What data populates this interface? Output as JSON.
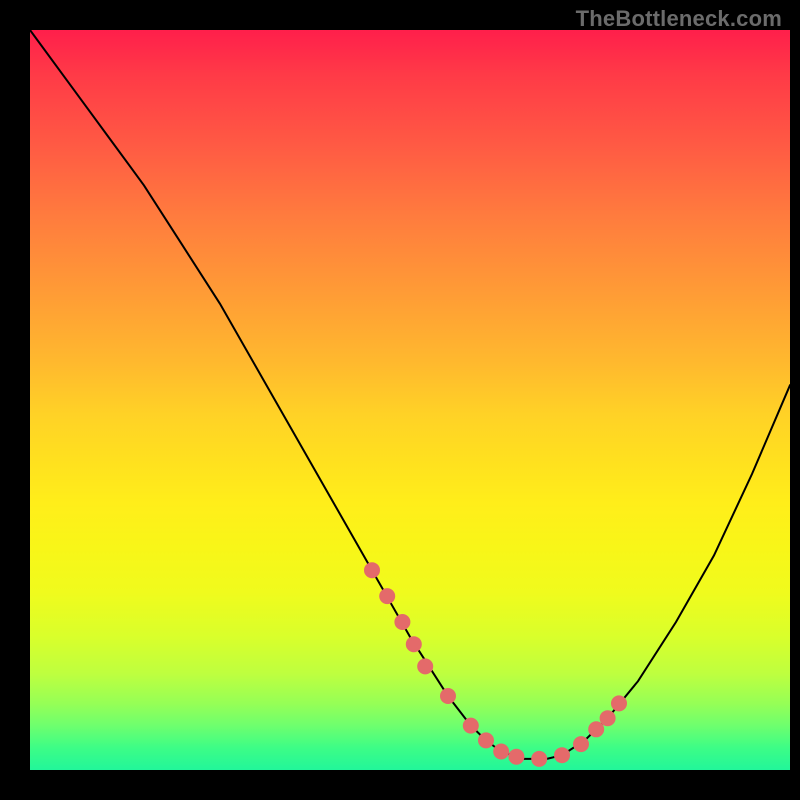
{
  "watermark": "TheBottleneck.com",
  "chart_data": {
    "type": "line",
    "title": "",
    "xlabel": "",
    "ylabel": "",
    "xlim": [
      0,
      100
    ],
    "ylim": [
      0,
      100
    ],
    "series": [
      {
        "name": "curve",
        "x": [
          0,
          5,
          10,
          15,
          20,
          25,
          30,
          35,
          40,
          45,
          50,
          55,
          58,
          60,
          62,
          65,
          68,
          70,
          73,
          76,
          80,
          85,
          90,
          95,
          100
        ],
        "values": [
          100,
          93,
          86,
          79,
          71,
          63,
          54,
          45,
          36,
          27,
          18,
          10,
          6,
          4,
          2.5,
          1.5,
          1.5,
          2,
          4,
          7,
          12,
          20,
          29,
          40,
          52
        ]
      },
      {
        "name": "dots",
        "x": [
          45,
          47,
          49,
          50.5,
          52,
          55,
          58,
          60,
          62,
          64,
          67,
          70,
          72.5,
          74.5,
          76,
          77.5
        ],
        "values": [
          27,
          23.5,
          20,
          17,
          14,
          10,
          6,
          4,
          2.5,
          1.8,
          1.5,
          2,
          3.5,
          5.5,
          7,
          9
        ]
      }
    ],
    "notes": "Axis values estimated on a 0–100 normalized scale; no numeric axis labels are visible in the rendered image."
  }
}
